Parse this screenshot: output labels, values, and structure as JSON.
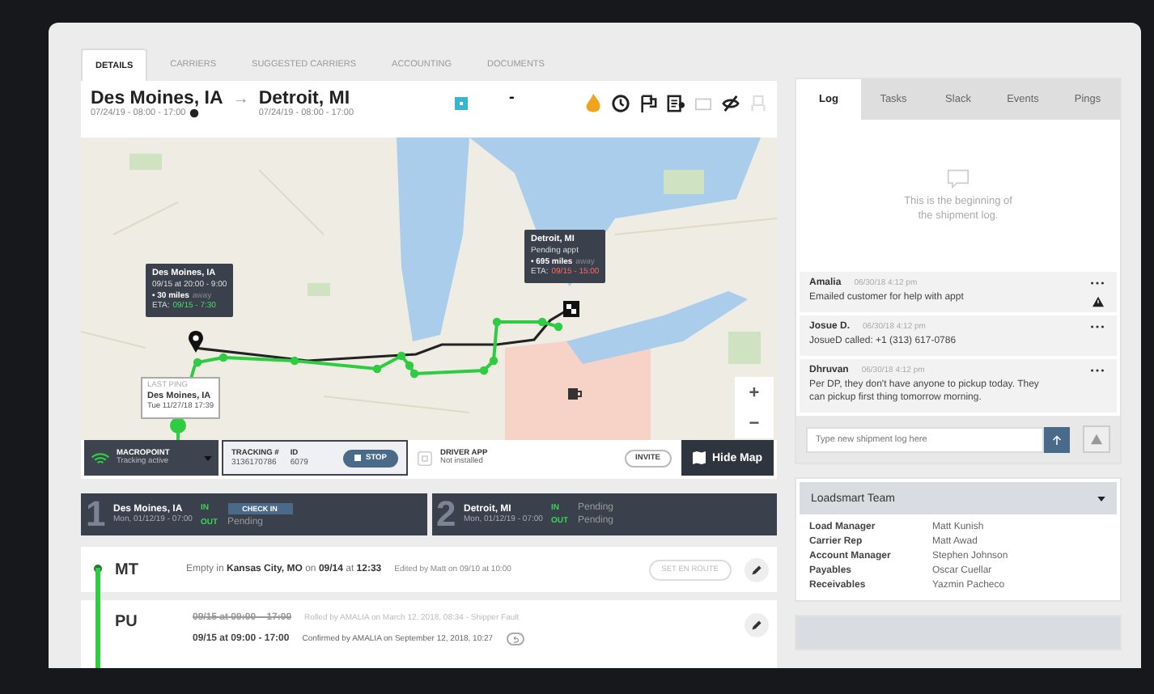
{
  "tabs": [
    {
      "label": "DETAILS",
      "selected": true
    },
    {
      "label": "CARRIERS",
      "selected": false
    },
    {
      "label": "SUGGESTED CARRIERS",
      "selected": false
    },
    {
      "label": "ACCOUNTING",
      "selected": false
    },
    {
      "label": "DOCUMENTS",
      "selected": false
    }
  ],
  "route": {
    "origin": {
      "city": "Des Moines, IA",
      "window": "07/24/19 - 08:00 - 17:00"
    },
    "destination": {
      "city": "Detroit, MI",
      "window": "07/24/19 - 08:00 - 17:00"
    },
    "arrow": "→",
    "dash": "-"
  },
  "map": {
    "origin_popup": {
      "title": "Des Moines, IA",
      "time": "09/15 at 20:00 - 9:00",
      "distance": "• 30 miles",
      "distance_note": "away",
      "eta_label": "ETA:",
      "eta": "09/15 - 7:30"
    },
    "destination_popup": {
      "title": "Detroit, MI",
      "time": "Pending appt",
      "distance": "• 695 miles",
      "distance_note": "away",
      "eta_label": "ETA:",
      "eta": "09/15 - 15:00"
    },
    "last_ping": {
      "label": "LAST PING",
      "city": "Des Moines, IA",
      "time": "Tue 11/27/18 17:39"
    },
    "zoom_in": "+",
    "zoom_out": "−"
  },
  "tracking": {
    "provider": "MACROPOINT",
    "status": "Tracking active",
    "tracking_label": "TRACKING #",
    "tracking_number": "3136170786",
    "id_label": "ID",
    "id": "6079",
    "stop": "STOP",
    "driver_app": "DRIVER APP",
    "driver_status": "Not installed",
    "invite": "INVITE",
    "hide_map": "Hide Map"
  },
  "stops": [
    {
      "number": "1",
      "city": "Des Moines, IA",
      "date": "Mon, 01/12/19 - 07:00",
      "in_label": "IN",
      "in": {
        "kind": "button",
        "label": "CHECK IN"
      },
      "out_label": "OUT",
      "out": "Pending"
    },
    {
      "number": "2",
      "city": "Detroit, MI",
      "date": "Mon, 01/12/19 - 07:00",
      "in_label": "IN",
      "in": {
        "kind": "text",
        "label": "Pending"
      },
      "out_label": "OUT",
      "out": "Pending"
    }
  ],
  "events": [
    {
      "code": "MT",
      "kind": "status",
      "text": "Empty in **Kansas City, MO** on **09/14** at **12:33**",
      "note": "Edited by Matt on 09/10 at 10:00",
      "action": "SET EN ROUTE"
    },
    {
      "code": "PU",
      "kind": "times",
      "lines": [
        {
          "time": "09/15 at 09:00 – 17:00",
          "struck": true,
          "note": "Rolled by AMALIA on March 12, 2018, 08:34 - Shipper Fault"
        },
        {
          "time": "09/15 at 09:00 - 17:00",
          "struck": false,
          "note": "Confirmed by AMALIA on September 12, 2018, 10:27"
        }
      ]
    }
  ],
  "log": {
    "tabs": [
      {
        "label": "Log",
        "selected": true
      },
      {
        "label": "Tasks",
        "selected": false
      },
      {
        "label": "Slack",
        "selected": false
      },
      {
        "label": "Events",
        "selected": false
      },
      {
        "label": "Pings",
        "selected": false
      }
    ],
    "empty": "This is the beginning of the shipment log.",
    "entries": [
      {
        "author": "Amalia",
        "time": "06/30/18 4:12 pm",
        "text": "Emailed customer for help with appt",
        "flagged": true
      },
      {
        "author": "Josue D.",
        "time": "06/30/18 4:12 pm",
        "text": "JosueD called: +1 (313) 617-0786",
        "flagged": false
      },
      {
        "author": "Dhruvan",
        "time": "06/30/18 4:12 pm",
        "text": "Per DP, they don't have anyone to pickup today. They can pickup first thing tomorrow morning.",
        "flagged": false
      }
    ],
    "input_placeholder": "Type new shipment log here"
  },
  "team": {
    "title": "Loadsmart Team",
    "expanded": true,
    "rows": [
      {
        "label": "Load Manager",
        "value": "Matt Kunish"
      },
      {
        "label": "Carrier Rep",
        "value": "Matt Awad"
      },
      {
        "label": "Account Manager",
        "value": "Stephen Johnson"
      },
      {
        "label": "Payables",
        "value": "Oscar Cuellar"
      },
      {
        "label": "Receivables",
        "value": "Yazmin Pacheco"
      }
    ]
  }
}
